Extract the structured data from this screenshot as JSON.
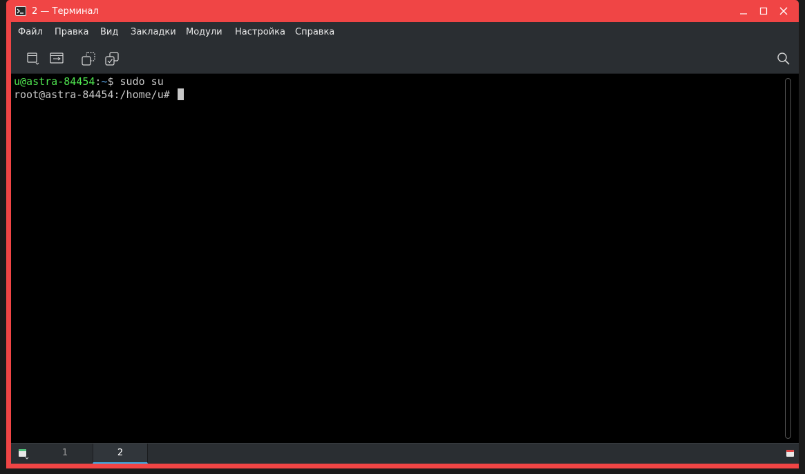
{
  "window": {
    "title": "2 — Терминал",
    "accent_color": "#f04545",
    "title_icon": "terminal-icon",
    "controls": [
      "minimize-icon",
      "maximize-icon",
      "close-icon"
    ]
  },
  "menubar": {
    "items": [
      "Файл",
      "Правка",
      "Вид",
      "Закладки",
      "Модули",
      "Настройка",
      "Справка"
    ]
  },
  "toolbar": {
    "buttons": [
      "new-tab-icon",
      "split-view-icon",
      "copy-icon",
      "paste-icon"
    ],
    "search": "search-icon"
  },
  "terminal": {
    "line1": {
      "user_host": "u@astra-84454",
      "colon": ":",
      "path": "~",
      "prompt": "$ ",
      "command": "sudo su"
    },
    "line2": {
      "prompt": "root@astra-84454:/home/u# "
    },
    "colors": {
      "user_host": "#4fe34f",
      "path": "#5aa7e8",
      "text": "#c8c8c8",
      "background": "#000000"
    }
  },
  "tabs": {
    "items": [
      "1",
      "2"
    ],
    "active": "2",
    "active_color": "#3daee9"
  }
}
